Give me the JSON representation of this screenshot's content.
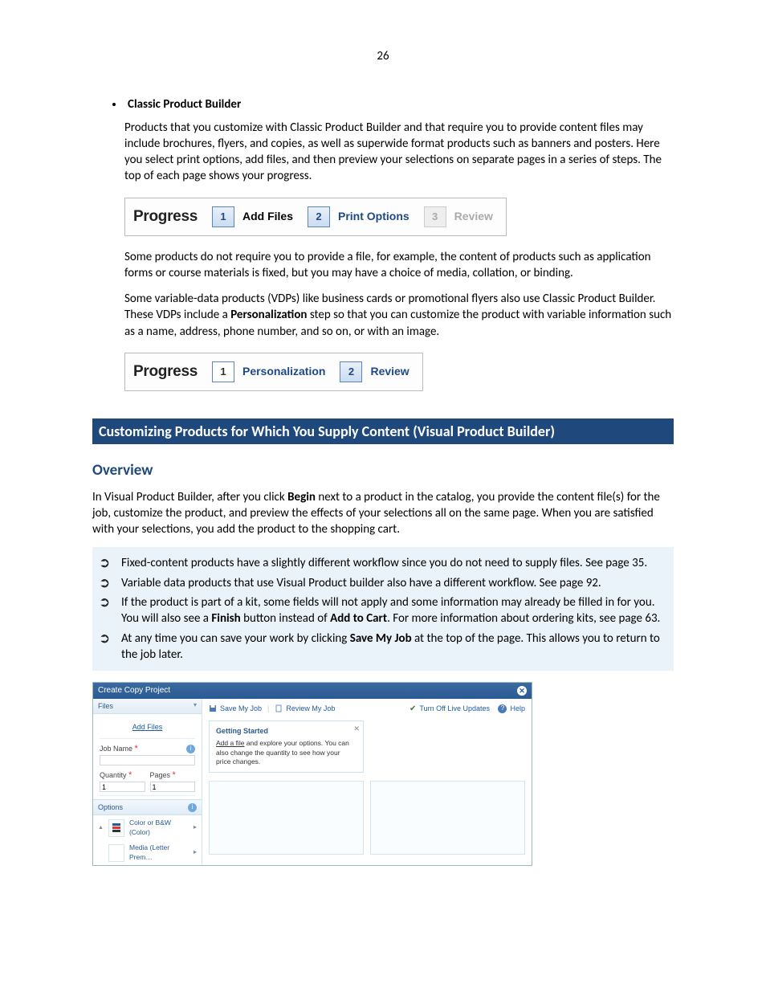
{
  "page_number": "26",
  "bullet1_title": "Classic Product Builder",
  "para1": "Products that you customize with Classic Product Builder and that require you to provide content files may include brochures, flyers, and copies, as well as superwide format products such as banners and posters. Here you select print options, add files, and then preview your selections on separate pages in a series of steps. The top of each page shows your progress.",
  "progress1": {
    "label": "Progress",
    "s1_num": "1",
    "s1_txt": "Add Files",
    "s2_num": "2",
    "s2_txt": "Print Options",
    "s3_num": "3",
    "s3_txt": "Review"
  },
  "para2": "Some products do not require you to provide a file, for example, the content of products such as application forms or course materials is fixed, but you may have a choice of media, collation, or binding.",
  "para3a": "Some variable-data products (VDPs) like business cards or promotional flyers also use Classic Product Builder. These VDPs include a ",
  "para3b": "Personalization",
  "para3c": " step so that you can customize the product with variable information such as a name, address, phone number, and so on, or with an image.",
  "progress2": {
    "label": "Progress",
    "s1_num": "1",
    "s1_txt": "Personalization",
    "s2_num": "2",
    "s2_txt": "Review"
  },
  "section_heading": "Customizing Products for Which You Supply Content (Visual Product Builder)",
  "overview_h": "Overview",
  "over_p_a": "In Visual Product Builder, after you click ",
  "over_p_b": "Begin",
  "over_p_c": " next to a product in the catalog, you provide the content file(s) for the job, customize the product, and preview the effects of your selections all on the same page. When you are satisfied with your selections, you add the product to the shopping cart.",
  "note1": "Fixed-content products have a slightly different workflow since you do not need to supply files. See page 35.",
  "note2": "Variable data products that use Visual Product builder also have a different workflow. See page 92.",
  "note3a": "If the product is part of a kit, some fields will not apply and some information may already be filled in for you. You will also see a ",
  "note3b": "Finish",
  "note3c": " button instead of ",
  "note3d": "Add to Cart",
  "note3e": ". For more information about ordering kits, see page 63.",
  "note4a": " At any time you can save your work by clicking ",
  "note4b": "Save My Job",
  "note4c": " at the top of the page. This allows you to return to the job later.",
  "app": {
    "title": "Create Copy Project",
    "files_hdr": "Files",
    "add_files": "Add Files",
    "job_name_lbl": "Job Name",
    "qty_lbl": "Quantity",
    "qty_val": "1",
    "pages_lbl": "Pages",
    "pages_val": "1",
    "options_hdr": "Options",
    "opt1": "Color or B&W (Color)",
    "opt2": "Media (Letter Prem…",
    "save_job": "Save My Job",
    "review_job": "Review My Job",
    "live_updates": "Turn Off Live Updates",
    "help": "Help",
    "tip_title": "Getting Started",
    "tip_a": "Add a file",
    "tip_b": " and explore your options. You can also change the quantity to see how your price changes."
  }
}
